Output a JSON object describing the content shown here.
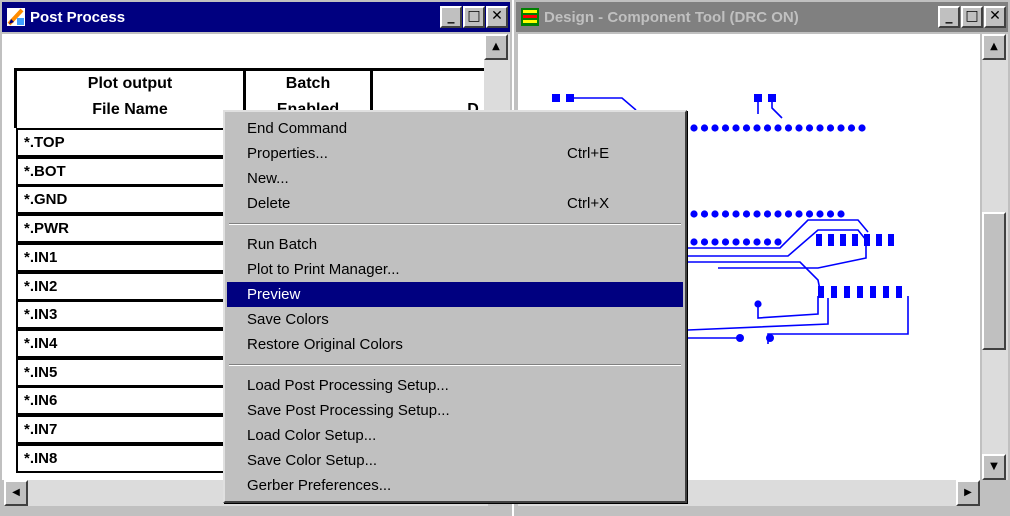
{
  "post_window": {
    "title": "Post Process",
    "columns": [
      "Plot output\nFile Name",
      "Batch\nEnabled",
      "D"
    ],
    "col1_line1": "Plot output",
    "col1_line2": "File Name",
    "col2_line1": "Batch",
    "col2_line2": "Enabled",
    "col3_partial": "D",
    "rows": [
      "*.TOP",
      "*.BOT",
      "*.GND",
      "*.PWR",
      "*.IN1",
      "*.IN2",
      "*.IN3",
      "*.IN4",
      "*.IN5",
      "*.IN6",
      "*.IN7",
      "*.IN8"
    ]
  },
  "design_window": {
    "title": "Design - Component Tool (DRC ON)",
    "trace_color": "#0000ff"
  },
  "caption_buttons": {
    "minimize": "_",
    "maximize": "□",
    "close": "✕"
  },
  "scroll_arrows": {
    "up": "▲",
    "down": "▼",
    "left": "◀",
    "right": "▶"
  },
  "context_menu": {
    "items": [
      {
        "label": "End Command",
        "shortcut": ""
      },
      {
        "label": "Properties...",
        "shortcut": "Ctrl+E"
      },
      {
        "label": "New...",
        "shortcut": ""
      },
      {
        "label": "Delete",
        "shortcut": "Ctrl+X"
      },
      {
        "label": "Run Batch",
        "shortcut": ""
      },
      {
        "label": "Plot to Print Manager...",
        "shortcut": ""
      },
      {
        "label": "Preview",
        "shortcut": "",
        "selected": true
      },
      {
        "label": "Save Colors",
        "shortcut": ""
      },
      {
        "label": "Restore Original Colors",
        "shortcut": ""
      },
      {
        "label": "Load Post Processing Setup...",
        "shortcut": ""
      },
      {
        "label": "Save Post Processing Setup...",
        "shortcut": ""
      },
      {
        "label": "Load Color Setup...",
        "shortcut": ""
      },
      {
        "label": "Save Color Setup...",
        "shortcut": ""
      },
      {
        "label": "Gerber Preferences...",
        "shortcut": ""
      }
    ]
  },
  "colors": {
    "active_title": "#000080",
    "inactive_title": "#808080",
    "menu_bg": "#c0c0c0",
    "highlight": "#000080"
  }
}
